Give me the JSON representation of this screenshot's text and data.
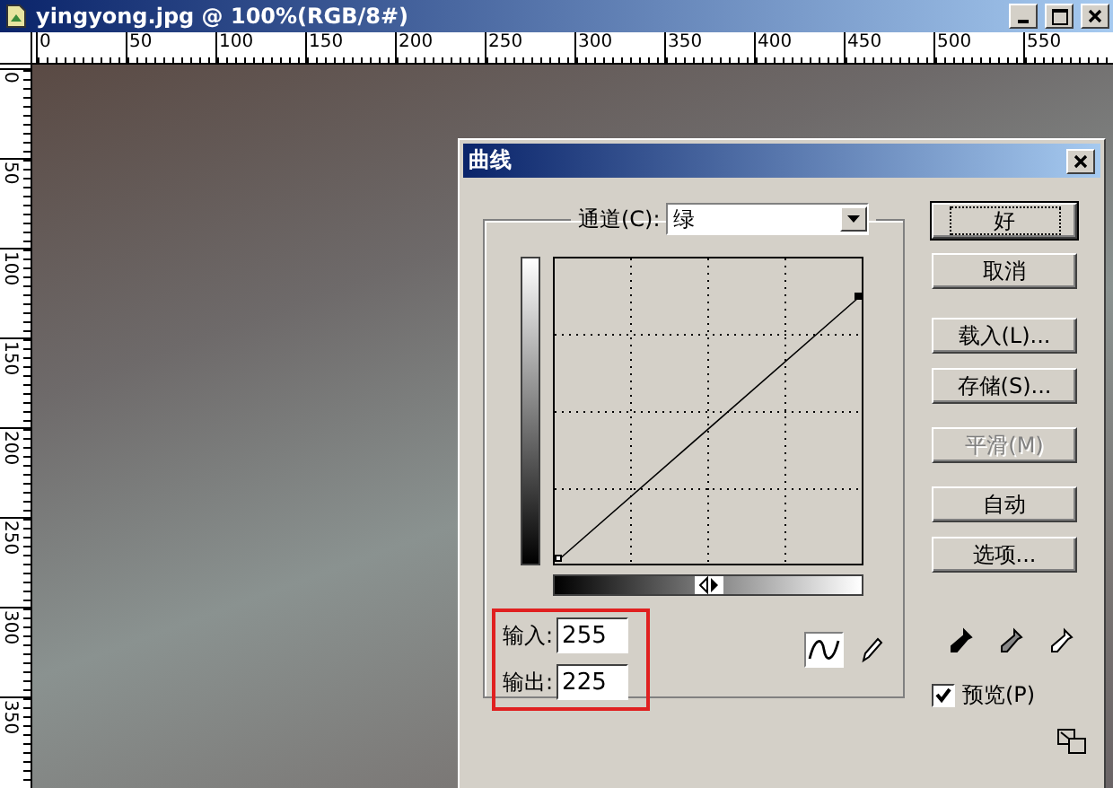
{
  "document_window": {
    "title": "yingyong.jpg @ 100%(RGB/8#)"
  },
  "rulers": {
    "horizontal": [
      "0",
      "50",
      "100",
      "150",
      "200",
      "250",
      "300",
      "350",
      "400",
      "450",
      "500",
      "550"
    ],
    "vertical": [
      "0",
      "50",
      "100",
      "150",
      "200",
      "250",
      "300",
      "350"
    ]
  },
  "curves_dialog": {
    "title": "曲线",
    "channel": {
      "label": "通道(C):",
      "value": "绿"
    },
    "input": {
      "label": "输入:",
      "value": "255"
    },
    "output": {
      "label": "输出:",
      "value": "225"
    },
    "curve_tools": [
      {
        "kind": "curve",
        "selected": true
      },
      {
        "kind": "pencil",
        "selected": false
      }
    ],
    "buttons": [
      {
        "label": "好",
        "default": true,
        "disabled": false
      },
      {
        "label": "取消",
        "default": false,
        "disabled": false
      },
      {
        "label": "载入(L)...",
        "default": false,
        "disabled": false
      },
      {
        "label": "存储(S)...",
        "default": false,
        "disabled": false
      },
      {
        "label": "平滑(M)",
        "default": false,
        "disabled": true
      },
      {
        "label": "自动",
        "default": false,
        "disabled": false
      },
      {
        "label": "选项...",
        "default": false,
        "disabled": false
      }
    ],
    "eyedroppers": [
      {
        "kind": "black"
      },
      {
        "kind": "gray"
      },
      {
        "kind": "white"
      }
    ],
    "preview": {
      "label": "预览(P)",
      "checked": true
    }
  }
}
